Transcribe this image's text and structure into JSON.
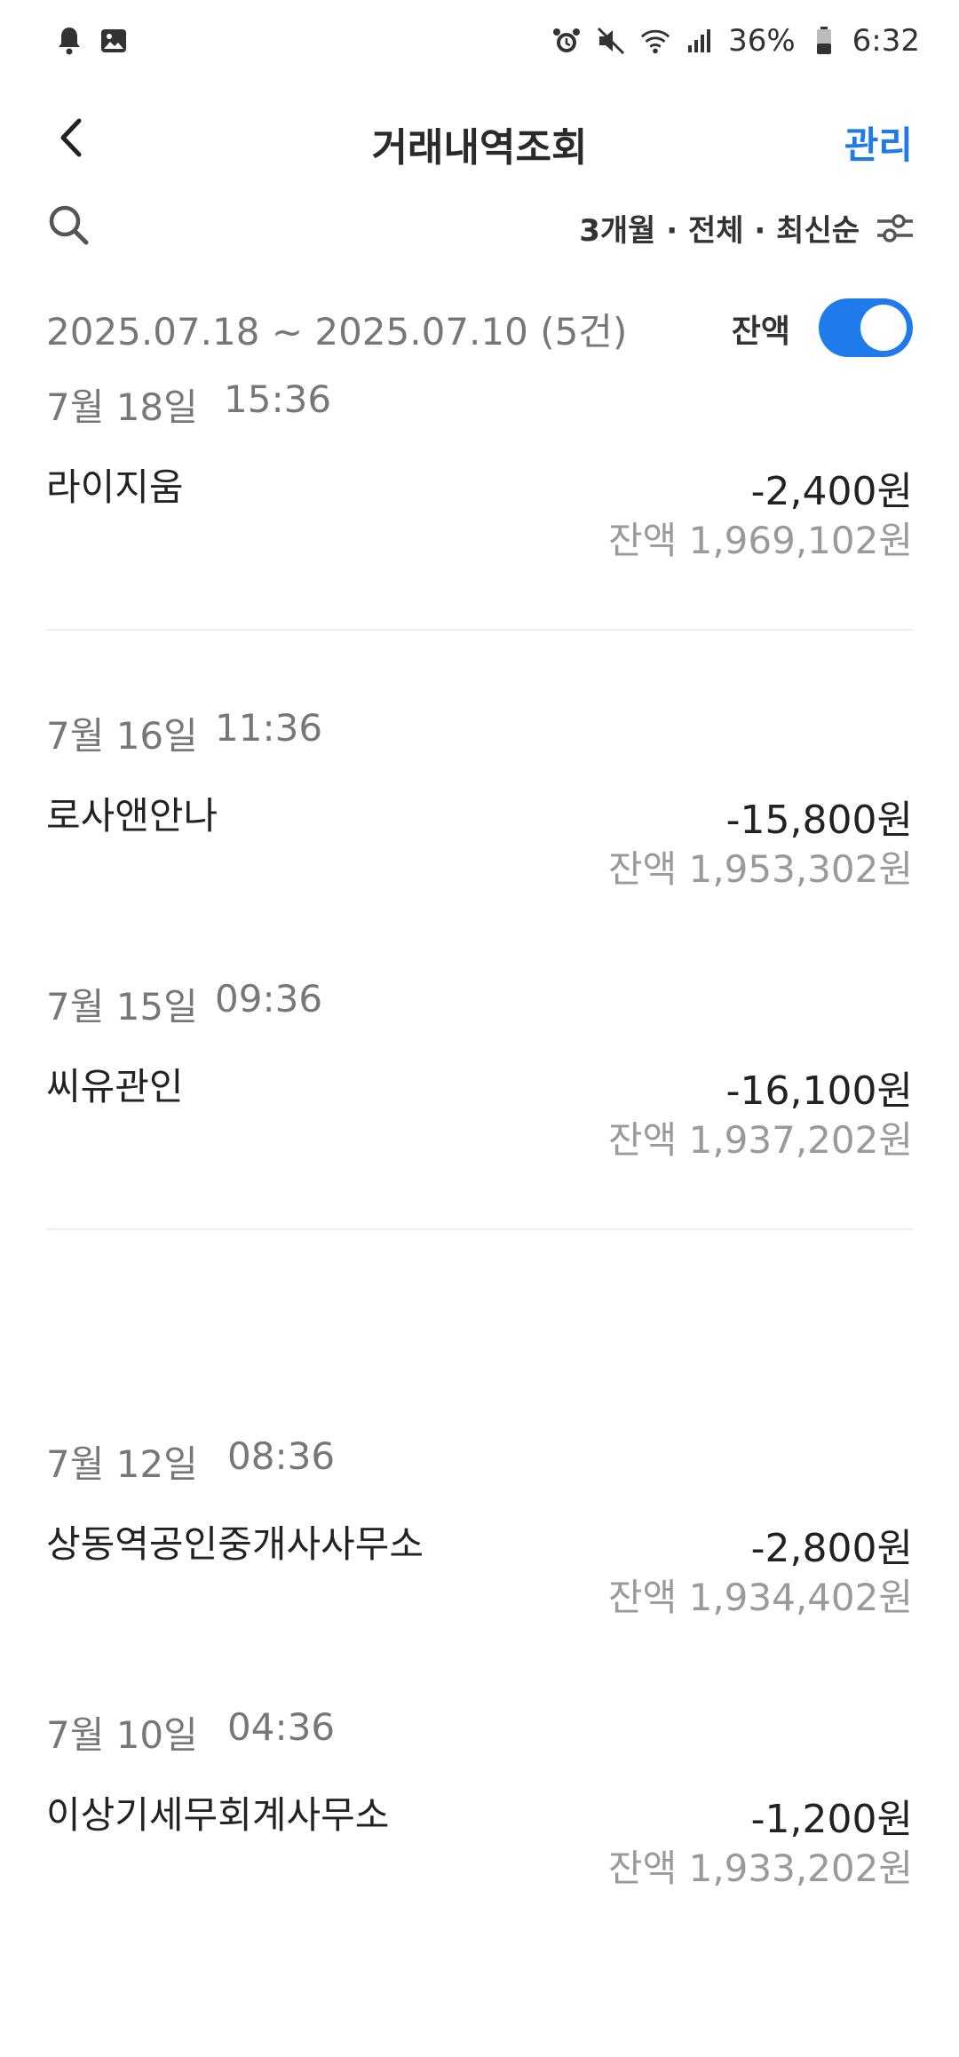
{
  "statusbar": {
    "battery": "36%",
    "time": "6:32"
  },
  "header": {
    "title": "거래내역조회",
    "manage": "관리"
  },
  "toolbar": {
    "filter": "3개월 · 전체 · 최신순"
  },
  "summary": {
    "range": "2025.07.18 ~ 2025.07.10 (5건)",
    "balance_label": "잔액",
    "balance_toggle_on": true
  },
  "colors": {
    "accent": "#1f7aec",
    "muted": "#9a9a9a"
  },
  "transactions": [
    {
      "date": "7월 18일",
      "time": "15:36",
      "name": "라이지움",
      "amount": "-2,400원",
      "balance": "잔액 1,969,102원"
    },
    {
      "date": "7월 16일",
      "time": "11:36",
      "name": "로사앤안나",
      "amount": "-15,800원",
      "balance": "잔액 1,953,302원"
    },
    {
      "date": "7월 15일",
      "time": "09:36",
      "name": "씨유관인",
      "amount": "-16,100원",
      "balance": "잔액 1,937,202원"
    },
    {
      "date": "7월 12일",
      "time": "08:36",
      "name": "상동역공인중개사사무소",
      "amount": "-2,800원",
      "balance": "잔액 1,934,402원"
    },
    {
      "date": "7월 10일",
      "time": "04:36",
      "name": "이상기세무회계사무소",
      "amount": "-1,200원",
      "balance": "잔액 1,933,202원"
    }
  ]
}
